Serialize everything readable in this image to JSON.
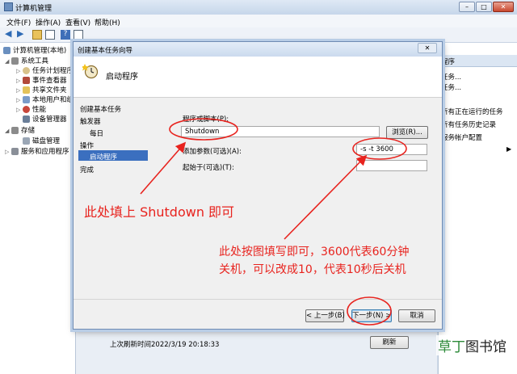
{
  "window": {
    "title": "计算机管理",
    "controls": {
      "minimize": "–",
      "maximize": "□",
      "close": "✕"
    }
  },
  "menu": [
    "文件(F)",
    "操作(A)",
    "查看(V)",
    "帮助(H)"
  ],
  "tree": {
    "root": "计算机管理(本地)",
    "items": [
      {
        "label": "系统工具",
        "level": 1
      },
      {
        "label": "任务计划程序",
        "level": 2
      },
      {
        "label": "事件查看器",
        "level": 2
      },
      {
        "label": "共享文件夹",
        "level": 2
      },
      {
        "label": "本地用户和组",
        "level": 2
      },
      {
        "label": "性能",
        "level": 2
      },
      {
        "label": "设备管理器",
        "level": 2
      },
      {
        "label": "存储",
        "level": 1
      },
      {
        "label": "磁盘管理",
        "level": 2
      },
      {
        "label": "服务和应用程序",
        "level": 1
      }
    ]
  },
  "actions": {
    "header": "程序",
    "items": [
      "任务...",
      "任务...",
      "",
      "所有正在运行的任务",
      "所有任务历史记录",
      "服务帐户配置",
      ""
    ]
  },
  "status": {
    "last_refresh": "上次刷新时间2022/3/19 20:18:33",
    "refresh_button": "刷新"
  },
  "dialog": {
    "title": "创建基本任务向导",
    "close": "✕",
    "header_title": "启动程序",
    "steps": [
      "创建基本任务",
      "触发器",
      "每日",
      "操作",
      "启动程序",
      "完成"
    ],
    "program_label": "程序或脚本(P):",
    "program_value": "Shutdown",
    "browse_button": "浏览(R)...",
    "args_label": "添加参数(可选)(A):",
    "args_value": "-s -t 3600",
    "start_in_label": "起始于(可选)(T):",
    "start_in_value": "",
    "back_button": "< 上一步(B)",
    "next_button": "下一步(N) >",
    "cancel_button": "取消"
  },
  "annotations": {
    "note1": "此处填上 Shutdown 即可",
    "note2_line1": "此处按图填写即可，3600代表60分钟",
    "note2_line2": "关机，可以改成10，代表10秒后关机",
    "color": "#e8231e"
  },
  "watermark": {
    "accent": "草丁",
    "rest": "图书馆"
  }
}
